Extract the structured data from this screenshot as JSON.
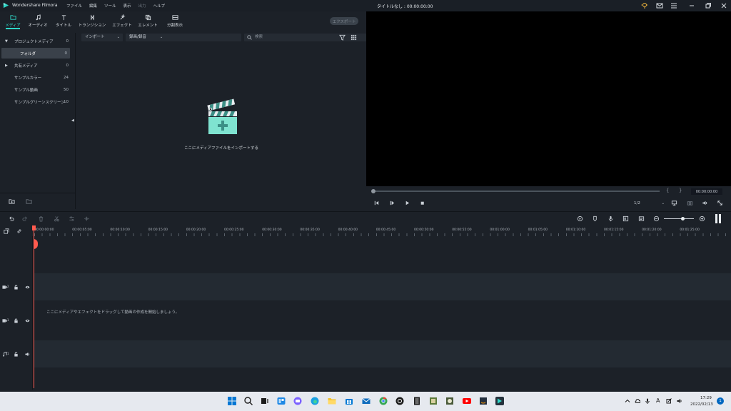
{
  "titlebar": {
    "app_name": "Wondershare Filmora",
    "menus": [
      "ファイル",
      "編集",
      "ツール",
      "表示",
      "出力",
      "ヘルプ"
    ],
    "doc_title": "タイトルなし : 00:00:00:00"
  },
  "toolbar": {
    "tabs": [
      {
        "label": "メディア",
        "icon": "folder-icon"
      },
      {
        "label": "オーディオ",
        "icon": "music-note-icon"
      },
      {
        "label": "タイトル",
        "icon": "text-icon"
      },
      {
        "label": "トランジション",
        "icon": "transition-icon"
      },
      {
        "label": "エフェクト",
        "icon": "effects-icon"
      },
      {
        "label": "エレメント",
        "icon": "elements-icon"
      },
      {
        "label": "分割表示",
        "icon": "split-screen-icon"
      }
    ],
    "export_label": "エクスポート"
  },
  "sidebar": {
    "items": [
      {
        "label": "プロジェクトメディア",
        "count": "0",
        "arrow": "▼"
      },
      {
        "label": "フォルダ",
        "count": "0",
        "arrow": ""
      },
      {
        "label": "共有メディア",
        "count": "0",
        "arrow": "▶"
      },
      {
        "label": "サンプルカラー",
        "count": "24",
        "arrow": ""
      },
      {
        "label": "サンプル動画",
        "count": "50",
        "arrow": ""
      },
      {
        "label": "サンプルグリーンスクリーン",
        "count": "10",
        "arrow": ""
      }
    ]
  },
  "media": {
    "import_label": "インポート",
    "record_label": "録画/録音",
    "search_placeholder": "検索",
    "empty_hint": "ここにメディアファイルをインポートする"
  },
  "preview": {
    "timecode": "00:00:00:00",
    "ratio": "1/2",
    "bracket_left": "{",
    "bracket_right": "}"
  },
  "timeline": {
    "ruler_labels": [
      "00:00:00:00",
      "00:00:05:00",
      "00:00:10:00",
      "00:00:15:00",
      "00:00:20:00",
      "00:00:25:00",
      "00:00:30:00",
      "00:00:35:00",
      "00:00:40:00",
      "00:00:45:00",
      "00:00:50:00",
      "00:00:55:00",
      "00:01:00:00",
      "00:01:05:00",
      "00:01:10:00",
      "00:01:15:00",
      "00:01:20:00",
      "00:01:25:00"
    ],
    "drag_hint": "ここにメディアやエフェクトをドラッグして動画の作成を開始しましょう。",
    "track_labels": [
      "2",
      "1",
      "1"
    ]
  },
  "taskbar": {
    "time": "17:29",
    "date": "2022/02/13",
    "notification_count": "1",
    "ime_label": "A"
  },
  "colors": {
    "accent": "#2fd8c8",
    "playhead": "#ff5a4e",
    "panel": "#1c2128",
    "track": "#232a32"
  }
}
